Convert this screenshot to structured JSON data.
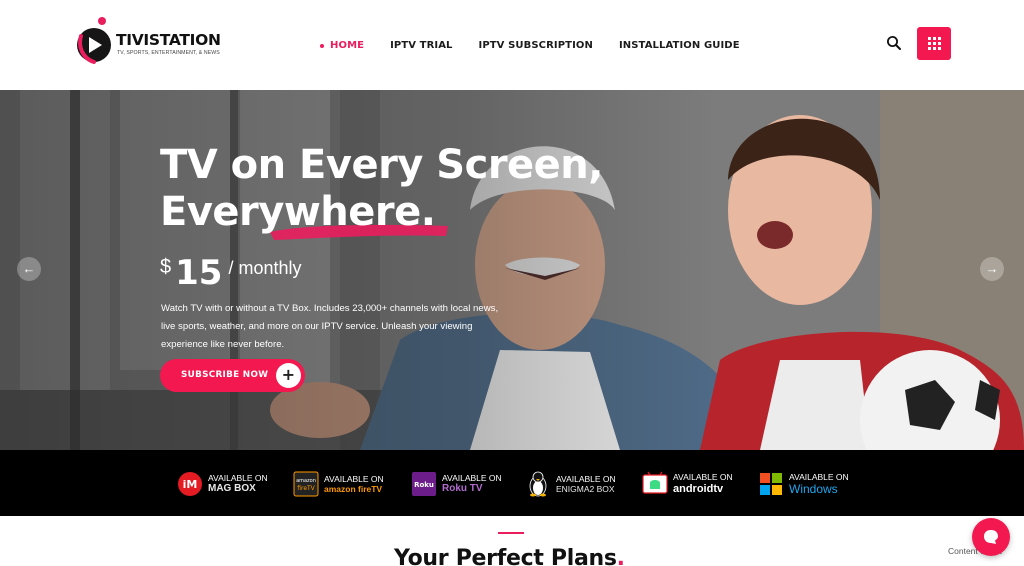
{
  "brand": {
    "name": "TIVISTATION",
    "tagline": "TV, SPORTS, ENTERTAINMENT, & NEWS"
  },
  "nav": {
    "items": [
      {
        "label": "HOME",
        "active": true
      },
      {
        "label": "IPTV TRIAL",
        "active": false
      },
      {
        "label": "IPTV SUBSCRIPTION",
        "active": false
      },
      {
        "label": "INSTALLATION GUIDE",
        "active": false
      }
    ],
    "search_icon": "search-icon",
    "menu_icon": "grid-menu-icon"
  },
  "hero": {
    "title_line1": "TV on Every Screen,",
    "title_line2": "Everywhere.",
    "price_currency": "$",
    "price_amount": "15",
    "price_period": "/ monthly",
    "description": "Watch TV with or without a TV Box. Includes 23,000+ channels with local news, live sports, weather, and more on our IPTV service. Unleash your viewing experience like never before.",
    "cta_label": "SUBSCRIBE NOW",
    "cta_icon": "+",
    "prev_icon": "←",
    "next_icon": "→"
  },
  "platforms": [
    {
      "top": "AVAILABLE ON",
      "bottom": "MAG BOX",
      "icon": "mag-icon",
      "color": "#e8e8e8"
    },
    {
      "top": "AVAILABLE ON",
      "bottom": "amazon fireTV",
      "icon": "amazon-firetv-icon",
      "color": "#ff9900"
    },
    {
      "top": "AVAILABLE ON",
      "bottom": "Roku TV",
      "icon": "roku-icon",
      "color": "#b46cd1"
    },
    {
      "top": "AVAILABLE ON",
      "bottom": "ENIGMA2 BOX",
      "icon": "linux-penguin-icon",
      "color": "#e8e8e8"
    },
    {
      "top": "AVAILABLE ON",
      "bottom": "androidtv",
      "icon": "android-tv-icon",
      "color": "#ffffff"
    },
    {
      "top": "AVAILABLE ON",
      "bottom": "Windows",
      "icon": "windows-icon",
      "color": "#1fa6ee"
    }
  ],
  "plans": {
    "title": "Your Perfect Plans",
    "title_dot": "."
  },
  "footer_text": "Content Script",
  "colors": {
    "accent": "#ea1d5d",
    "accent_button": "#f3184f",
    "platform_bar": "#000000"
  }
}
